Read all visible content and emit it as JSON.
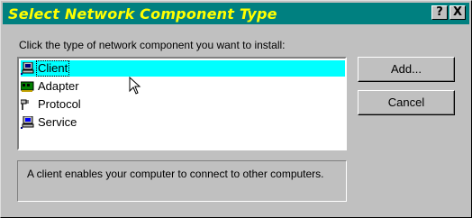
{
  "window": {
    "title": "Select Network Component Type",
    "help_label": "?",
    "close_label": "X"
  },
  "prompt": "Click the type of network component you want to install:",
  "components": [
    {
      "label": "Client",
      "icon": "client-computer-icon",
      "selected": true
    },
    {
      "label": "Adapter",
      "icon": "network-adapter-icon",
      "selected": false
    },
    {
      "label": "Protocol",
      "icon": "protocol-plug-icon",
      "selected": false
    },
    {
      "label": "Service",
      "icon": "service-computer-icon",
      "selected": false
    }
  ],
  "buttons": {
    "add": "Add...",
    "cancel": "Cancel"
  },
  "description": "A client enables your computer to connect to other computers.",
  "colors": {
    "titlebar": "#008080",
    "title_text": "#ffff00",
    "selection": "#00ffff",
    "face": "#c0c0c0"
  }
}
